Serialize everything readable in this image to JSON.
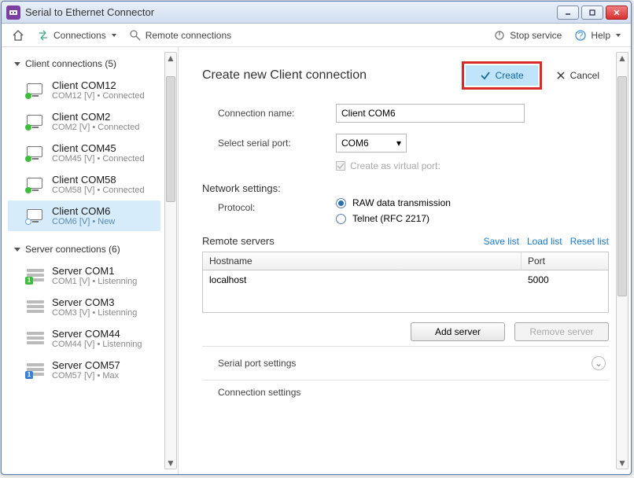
{
  "window": {
    "title": "Serial to Ethernet Connector"
  },
  "toolbar": {
    "connections": "Connections",
    "remote": "Remote connections",
    "stop": "Stop service",
    "help": "Help"
  },
  "sidebar": {
    "client": {
      "header": "Client connections (5)",
      "items": [
        {
          "name": "Client COM12",
          "sub": "COM12 [V] • Connected"
        },
        {
          "name": "Client COM2",
          "sub": "COM2 [V] • Connected"
        },
        {
          "name": "Client COM45",
          "sub": "COM45 [V] • Connected"
        },
        {
          "name": "Client COM58",
          "sub": "COM58 [V] • Connected"
        },
        {
          "name": "Client COM6",
          "sub": "COM6 [V] • New"
        }
      ]
    },
    "server": {
      "header": "Server connections (6)",
      "items": [
        {
          "name": "Server COM1",
          "sub": "COM1 [V] • Listenning"
        },
        {
          "name": "Server COM3",
          "sub": "COM3 [V] • Listenning"
        },
        {
          "name": "Server COM44",
          "sub": "COM44 [V] • Listenning"
        },
        {
          "name": "Server COM57",
          "sub": "COM57 [V] • Max"
        }
      ]
    }
  },
  "main": {
    "heading": "Create new Client connection",
    "create": "Create",
    "cancel": "Cancel",
    "conn_name_lbl": "Connection name:",
    "conn_name_val": "Client COM6",
    "port_lbl": "Select serial port:",
    "port_val": "COM6",
    "virtual_lbl": "Create as virtual port:",
    "net_title": "Network settings:",
    "protocol_lbl": "Protocol:",
    "protocol_raw": "RAW data transmission",
    "protocol_telnet": "Telnet (RFC 2217)",
    "remote_title": "Remote servers",
    "save_list": "Save list",
    "load_list": "Load list",
    "reset_list": "Reset list",
    "th_host": "Hostname",
    "th_port": "Port",
    "row_host": "localhost",
    "row_port": "5000",
    "add_server": "Add server",
    "remove_server": "Remove server",
    "serial_settings": "Serial port settings",
    "conn_settings": "Connection settings"
  }
}
